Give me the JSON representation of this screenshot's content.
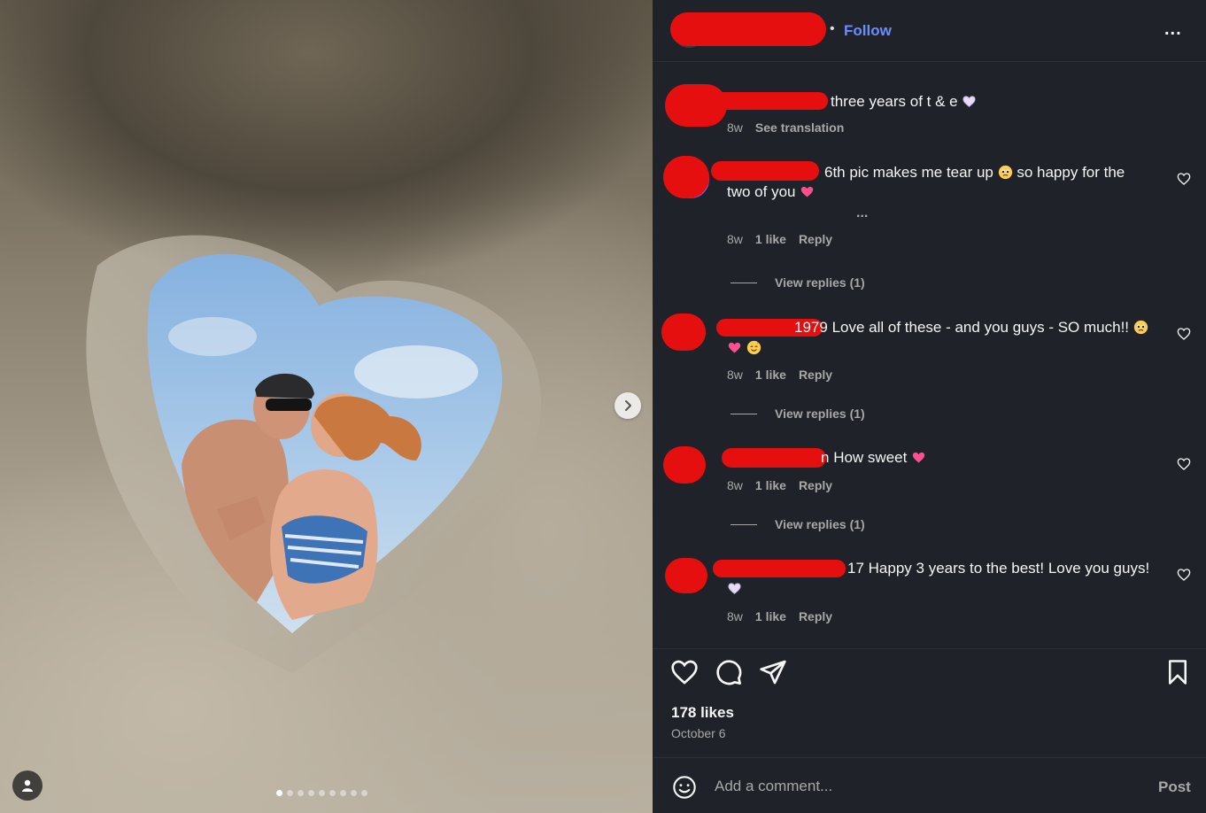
{
  "post": {
    "slide_count": 9,
    "current_slide": 1
  },
  "header": {
    "separator": "•",
    "follow_label": "Follow",
    "more_label": "..."
  },
  "caption": {
    "text": "three years of t & e",
    "emoji": "white-heart",
    "time": "8w",
    "see_translation": "See translation"
  },
  "comments": [
    {
      "text_line1": "6th pic makes me tear up",
      "text_mid": "so happy for the",
      "text_line2": "two of you",
      "time": "8w",
      "likes": "1 like",
      "reply": "Reply",
      "view_replies": "View replies (1)",
      "more": "..."
    },
    {
      "text_prefix": "1979",
      "text_line1": "Love all of these - and you guys - SO much!!",
      "time": "8w",
      "likes": "1 like",
      "reply": "Reply",
      "view_replies": "View replies (1)"
    },
    {
      "text_prefix": "n",
      "text_line1": "How sweet",
      "time": "8w",
      "likes": "1 like",
      "reply": "Reply",
      "view_replies": "View replies (1)"
    },
    {
      "text_prefix": "17",
      "text_line1": "Happy 3 years to the best! Love you guys!",
      "time": "8w",
      "likes": "1 like",
      "reply": "Reply"
    }
  ],
  "footer": {
    "likes": "178 likes",
    "date": "October 6",
    "comment_placeholder": "Add a comment...",
    "post_label": "Post"
  },
  "colors": {
    "panel_bg": "#1f2229",
    "accent": "#6c8dff",
    "redaction": "#e60f0f",
    "muted": "#a8a8a8"
  },
  "icons": [
    "chevron-right-icon",
    "user-tag-icon",
    "more-icon",
    "heart-icon",
    "comment-icon",
    "share-icon",
    "bookmark-icon",
    "emoji-icon",
    "pink-heart-emoji",
    "white-heart-emoji",
    "pleading-face-emoji",
    "smiling-hearts-emoji"
  ]
}
